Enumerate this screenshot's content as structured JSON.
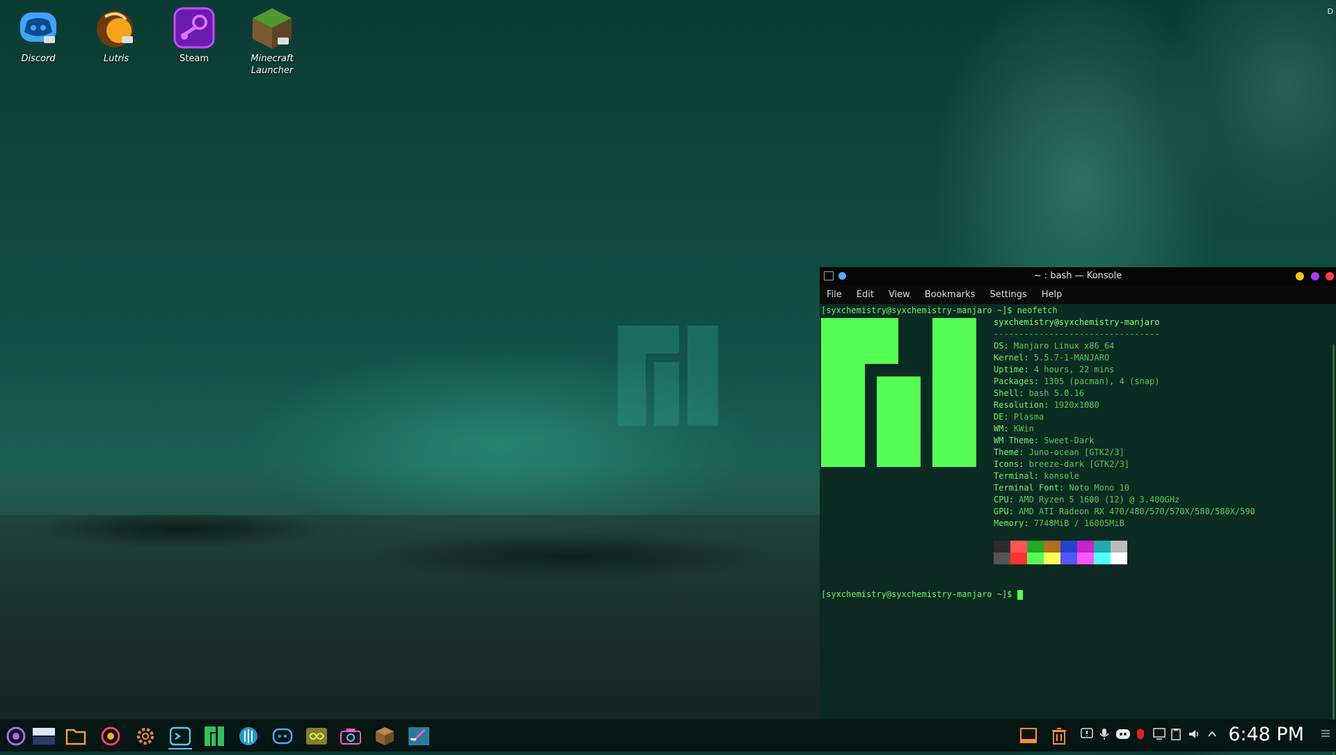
{
  "desktop": {
    "icons": [
      {
        "label": "Discord"
      },
      {
        "label": "Lutris"
      },
      {
        "label": "Steam"
      },
      {
        "label": "Minecraft Launcher"
      }
    ],
    "corner_label": "D"
  },
  "konsole": {
    "title": "~ : bash — Konsole",
    "menu": [
      "File",
      "Edit",
      "View",
      "Bookmarks",
      "Settings",
      "Help"
    ],
    "prompt": "[syxchemistry@syxchemistry-manjaro ~]$",
    "command": "neofetch",
    "user_host": "syxchemistry@syxchemistry-manjaro",
    "separator": "---------------------------------",
    "info": [
      {
        "key": "OS",
        "value": "Manjaro Linux x86_64"
      },
      {
        "key": "Kernel",
        "value": "5.5.7-1-MANJARO"
      },
      {
        "key": "Uptime",
        "value": "4 hours, 22 mins"
      },
      {
        "key": "Packages",
        "value": "1305 (pacman), 4 (snap)"
      },
      {
        "key": "Shell",
        "value": "bash 5.0.16"
      },
      {
        "key": "Resolution",
        "value": "1920x1080"
      },
      {
        "key": "DE",
        "value": "Plasma"
      },
      {
        "key": "WM",
        "value": "KWin"
      },
      {
        "key": "WM Theme",
        "value": "Sweet-Dark"
      },
      {
        "key": "Theme",
        "value": "Juno-ocean [GTK2/3]"
      },
      {
        "key": "Icons",
        "value": "breeze-dark [GTK2/3]"
      },
      {
        "key": "Terminal",
        "value": "konsole"
      },
      {
        "key": "Terminal Font",
        "value": "Noto Mono 10"
      },
      {
        "key": "CPU",
        "value": "AMD Ryzen 5 1600 (12) @ 3.400GHz"
      },
      {
        "key": "GPU",
        "value": "AMD ATI Radeon RX 470/480/570/570X/580/580X/590"
      },
      {
        "key": "Memory",
        "value": "7748MiB / 16005MiB"
      }
    ],
    "palette_top": [
      "#2c2c2c",
      "#ff5555",
      "#22aa22",
      "#b07020",
      "#2244cc",
      "#cc22cc",
      "#22aaaa",
      "#bbbbbb"
    ],
    "palette_bottom": [
      "#555555",
      "#ff3333",
      "#55ff55",
      "#ffff55",
      "#5555ff",
      "#ff55ff",
      "#55ffff",
      "#ffffff"
    ],
    "second_prompt": "[syxchemistry@syxchemistry-manjaro ~]$"
  },
  "taskbar": {
    "clock": "6:48 PM",
    "apps": [
      "application-launcher-icon",
      "pager-icon",
      "folder-icon",
      "firefox-icon",
      "settings-icon",
      "konsole-icon",
      "manjaro-icon",
      "discover-icon",
      "discord-icon",
      "lutris-icon",
      "camera-icon",
      "minecraft-icon",
      "kate-icon"
    ]
  }
}
